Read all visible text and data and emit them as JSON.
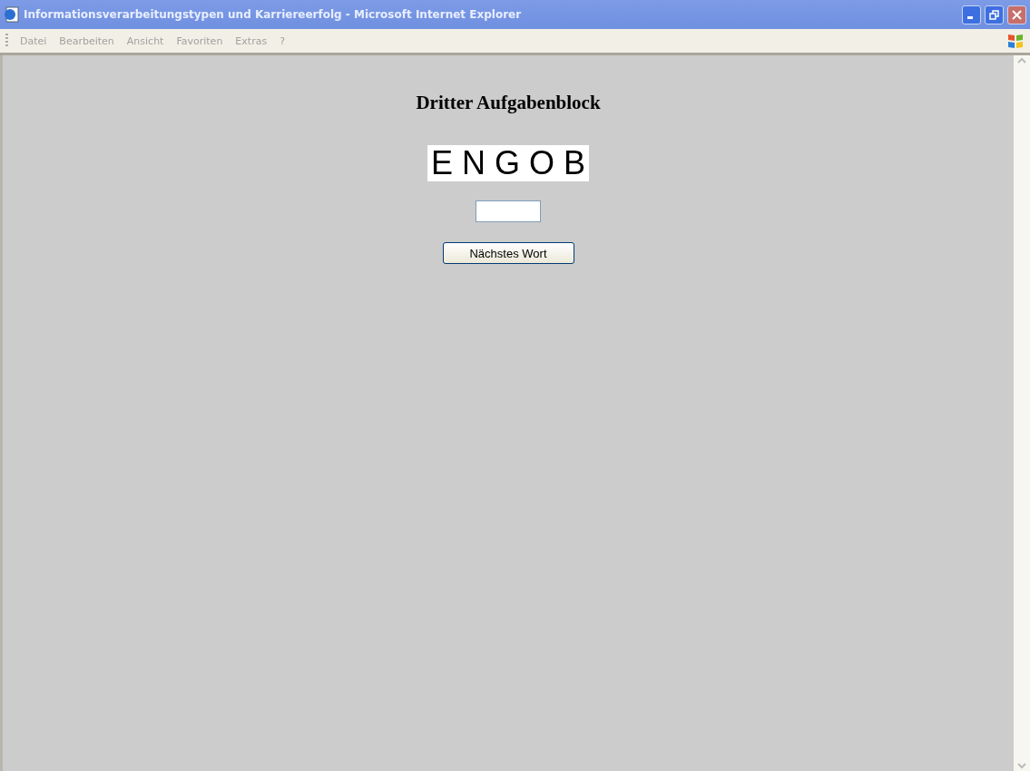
{
  "window": {
    "title": "Informationsverarbeitungstypen und Karriereerfolg - Microsoft Internet Explorer"
  },
  "menu": [
    "Datei",
    "Bearbeiten",
    "Ansicht",
    "Favoriten",
    "Extras",
    "?"
  ],
  "page": {
    "heading": "Dritter Aufgabenblock",
    "word": "E N G O B",
    "button": "Nächstes Wort"
  }
}
